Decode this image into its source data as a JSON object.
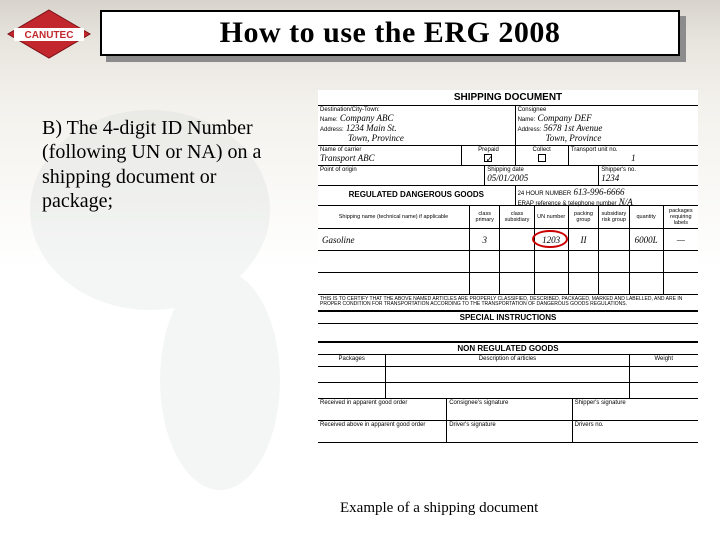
{
  "logo": {
    "label": "CANUTEC"
  },
  "title": "How to use the ERG 2008",
  "body": "B) The 4-digit ID Number (following UN or NA) on a shipping document or package;",
  "caption": "Example of a shipping document",
  "doc": {
    "header": "SHIPPING DOCUMENT",
    "dest_label": "Destination/City-Town:",
    "shipper": {
      "name_label": "Name:",
      "name": "Company ABC",
      "addr_label": "Address:",
      "addr1": "1234 Main St.",
      "addr2": "Town, Province"
    },
    "consignee": {
      "title": "Consignee",
      "name_label": "Name:",
      "name": "Company DEF",
      "addr_label": "Address:",
      "addr1": "5678 1st Avenue",
      "addr2": "Town, Province"
    },
    "carrier": {
      "label": "Name of carrier",
      "value": "Transport ABC",
      "prepaid": "Prepaid",
      "collect": "Collect"
    },
    "units": {
      "label": "Transport unit no.",
      "value": "1"
    },
    "origin_label": "Point of origin",
    "ship_date": {
      "label": "Shipping date",
      "value": "05/01/2005"
    },
    "ship_no": {
      "label": "Shipper's no.",
      "value": "1234"
    },
    "rdg_bar": "REGULATED DANGEROUS GOODS",
    "hr24": {
      "label": "24 HOUR NUMBER",
      "value": "613-996-6666"
    },
    "erap": {
      "label": "ERAP reference & telephone number",
      "value": "N/A"
    },
    "cols": {
      "shipping_name": "Shipping name (technical name) if applicable",
      "class_primary": "class primary",
      "class_subsidiary": "class subsidiary",
      "un": "UN number",
      "pg": "packing group",
      "risk": "subsidiary risk group",
      "qty": "quantity",
      "pkgs": "packages requiring labels"
    },
    "item": {
      "name": "Gasoline",
      "class": "3",
      "un": "1203",
      "pg": "II",
      "qty": "6000L"
    },
    "cert": "THIS IS TO CERTIFY THAT THE ABOVE NAMED ARTICLES ARE PROPERLY CLASSIFIED, DESCRIBED, PACKAGED, MARKED AND LABELLED, AND ARE IN PROPER CONDITION FOR TRANSPORTATION ACCORDING TO THE TRANSPORTATION OF DANGEROUS GOODS REGULATIONS.",
    "special_bar": "SPECIAL INSTRUCTIONS",
    "nonreg_bar": "NON REGULATED GOODS",
    "nr_cols": {
      "pkgs": "Packages",
      "desc": "Description of articles",
      "weight": "Weight"
    },
    "sig": {
      "good_order": "Received in apparent good order",
      "consignee": "Consignee's signature",
      "shipper": "Shipper's signature",
      "good_order2": "Received above in apparent good order",
      "driver": "Driver's signature",
      "driverno": "Drivers no."
    }
  }
}
